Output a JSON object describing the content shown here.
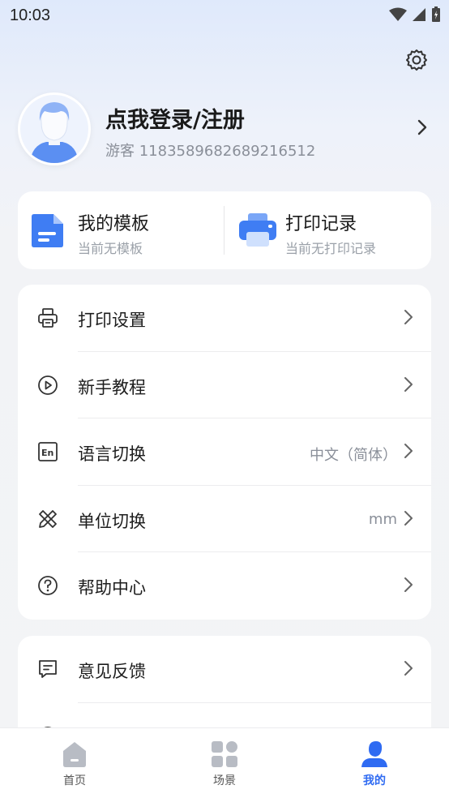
{
  "status_bar": {
    "time": "10:03"
  },
  "header": {
    "settings_icon": "gear-icon"
  },
  "profile": {
    "login_title": "点我登录/注册",
    "guest_id": "游客 1183589682689216512"
  },
  "quick": [
    {
      "title": "我的模板",
      "subtitle": "当前无模板",
      "icon": "document-icon"
    },
    {
      "title": "打印记录",
      "subtitle": "当前无打印记录",
      "icon": "printer-icon"
    }
  ],
  "menu_group1": [
    {
      "label": "打印设置",
      "value": "",
      "icon": "printer-outline-icon"
    },
    {
      "label": "新手教程",
      "value": "",
      "icon": "play-circle-icon"
    },
    {
      "label": "语言切换",
      "value": "中文（简体）",
      "icon": "language-en-icon"
    },
    {
      "label": "单位切换",
      "value": "mm",
      "icon": "ruler-pencil-icon"
    },
    {
      "label": "帮助中心",
      "value": "",
      "icon": "help-circle-icon"
    }
  ],
  "menu_group2": [
    {
      "label": "意见反馈",
      "value": "",
      "icon": "feedback-icon"
    }
  ],
  "tabbar": [
    {
      "label": "首页",
      "icon": "home-icon",
      "active": false
    },
    {
      "label": "场景",
      "icon": "grid-icon",
      "active": false
    },
    {
      "label": "我的",
      "icon": "user-icon",
      "active": true
    }
  ],
  "colors": {
    "accent": "#2f6bf2",
    "icon_blue": "#4a86f5"
  }
}
